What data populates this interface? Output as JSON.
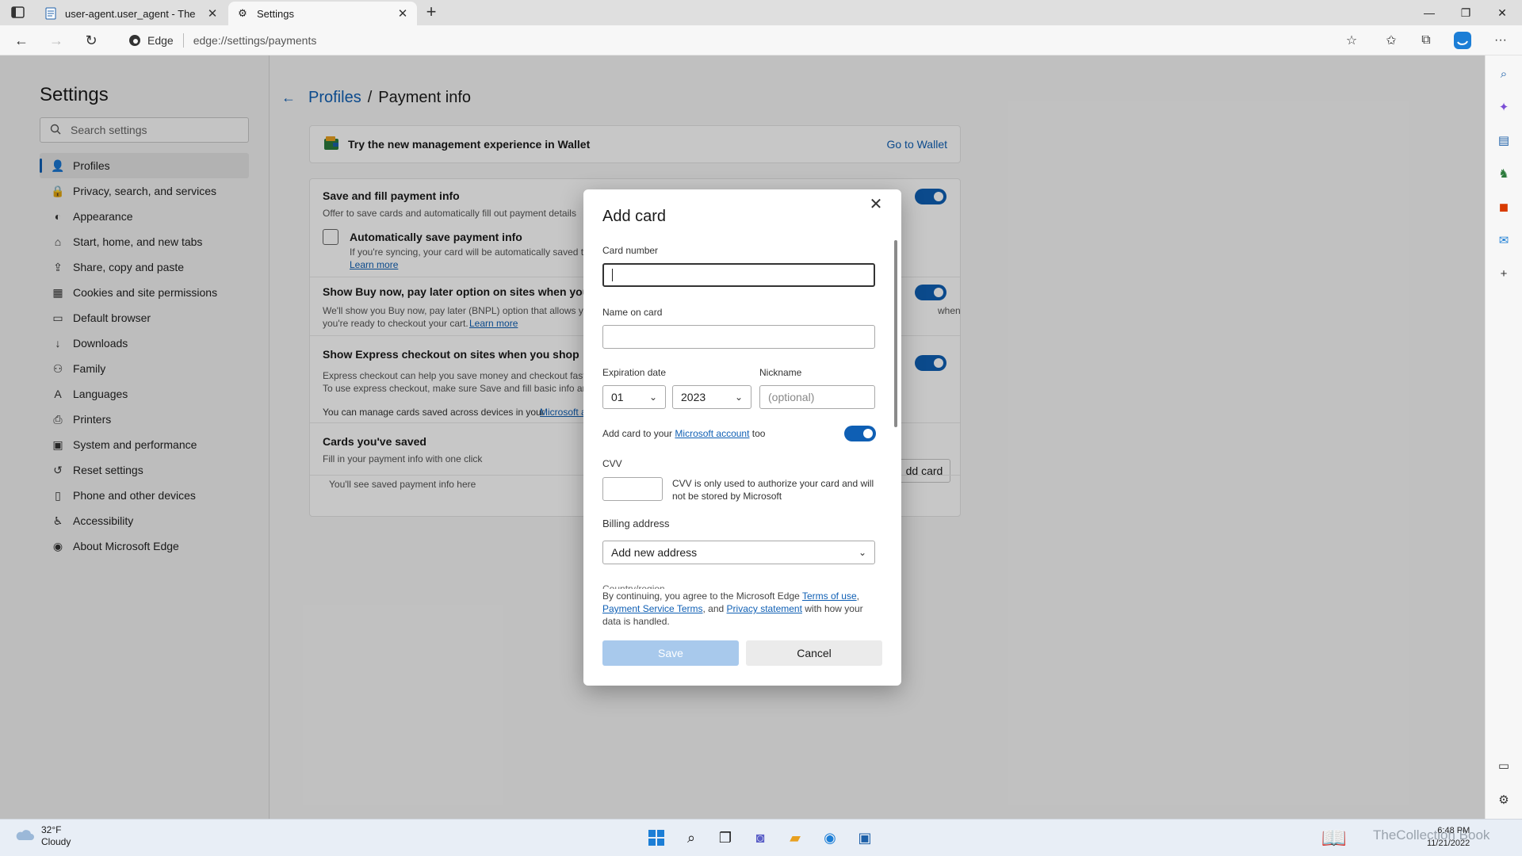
{
  "browser": {
    "tabs": [
      {
        "title": "user-agent.user_agent - The Coll"
      },
      {
        "title": "Settings"
      }
    ],
    "edge_label": "Edge",
    "url": "edge://settings/payments"
  },
  "settings": {
    "title": "Settings",
    "search_placeholder": "Search settings",
    "nav": [
      {
        "label": "Profiles",
        "icon": "person-icon"
      },
      {
        "label": "Privacy, search, and services",
        "icon": "lock-icon"
      },
      {
        "label": "Appearance",
        "icon": "palette-icon"
      },
      {
        "label": "Start, home, and new tabs",
        "icon": "home-icon"
      },
      {
        "label": "Share, copy and paste",
        "icon": "share-icon"
      },
      {
        "label": "Cookies and site permissions",
        "icon": "cookie-icon"
      },
      {
        "label": "Default browser",
        "icon": "browser-icon"
      },
      {
        "label": "Downloads",
        "icon": "download-icon"
      },
      {
        "label": "Family",
        "icon": "family-icon"
      },
      {
        "label": "Languages",
        "icon": "language-icon"
      },
      {
        "label": "Printers",
        "icon": "printer-icon"
      },
      {
        "label": "System and performance",
        "icon": "system-icon"
      },
      {
        "label": "Reset settings",
        "icon": "reset-icon"
      },
      {
        "label": "Phone and other devices",
        "icon": "phone-icon"
      },
      {
        "label": "Accessibility",
        "icon": "accessibility-icon"
      },
      {
        "label": "About Microsoft Edge",
        "icon": "edge-icon"
      }
    ]
  },
  "content": {
    "crumb_parent": "Profiles",
    "crumb_sep": "/",
    "crumb_current": "Payment info",
    "wallet_title": "Try the new management experience in Wallet",
    "wallet_link": "Go to Wallet",
    "save_fill_title": "Save and fill payment info",
    "save_fill_desc": "Offer to save cards and automatically fill out payment details",
    "auto_save_title": "Automatically save payment info",
    "auto_save_desc": "If you're syncing, your card will be automatically saved to",
    "learn_more": "Learn more",
    "bnpl_title": "Show Buy now, pay later option on sites when you sh",
    "bnpl_desc1": "We'll show you Buy now, pay later (BNPL) option that allows yo",
    "bnpl_desc1_tail": "when",
    "bnpl_desc2": "you're ready to checkout your cart.",
    "express_title": "Show Express checkout on sites when you shop",
    "express_desc1": "Express checkout can help you save money and checkout faste",
    "express_desc2": "To use express checkout, make sure Save and fill basic info and",
    "manage_text": "You can manage cards saved across devices in your",
    "manage_link": "Microsoft a",
    "cards_title": "Cards you've saved",
    "cards_desc": "Fill in your payment info with one click",
    "cards_empty": "You'll see saved payment info here",
    "add_card_btn": "dd card"
  },
  "dialog": {
    "title": "Add card",
    "card_number_label": "Card number",
    "card_number_value": "",
    "name_label": "Name on card",
    "name_value": "",
    "exp_label": "Expiration date",
    "exp_month": "01",
    "exp_year": "2023",
    "nickname_label": "Nickname",
    "nickname_placeholder": "(optional)",
    "ms_account_prefix": "Add card to your",
    "ms_account_link": "Microsoft account",
    "ms_account_suffix": "too",
    "cvv_label": "CVV",
    "cvv_note": "CVV is only used to authorize your card and will not be stored by Microsoft",
    "billing_label": "Billing address",
    "billing_value": "Add new address",
    "country_label": "Country/region",
    "terms_prefix": "By continuing, you agree to the Microsoft Edge",
    "terms_link": "Terms of use",
    "payment_terms_link": "Payment Service Terms",
    "terms_and": ", and",
    "privacy_link": "Privacy statement",
    "terms_suffix": "with how your data is handled.",
    "save_label": "Save",
    "cancel_label": "Cancel"
  },
  "taskbar": {
    "temp": "32°F",
    "condition": "Cloudy",
    "time": "6:48 PM",
    "date": "11/21/2022",
    "watermark": "TheCollection Book"
  },
  "colors": {
    "accent": "#0f5fb4",
    "save_disabled": "#a8c9ec"
  }
}
